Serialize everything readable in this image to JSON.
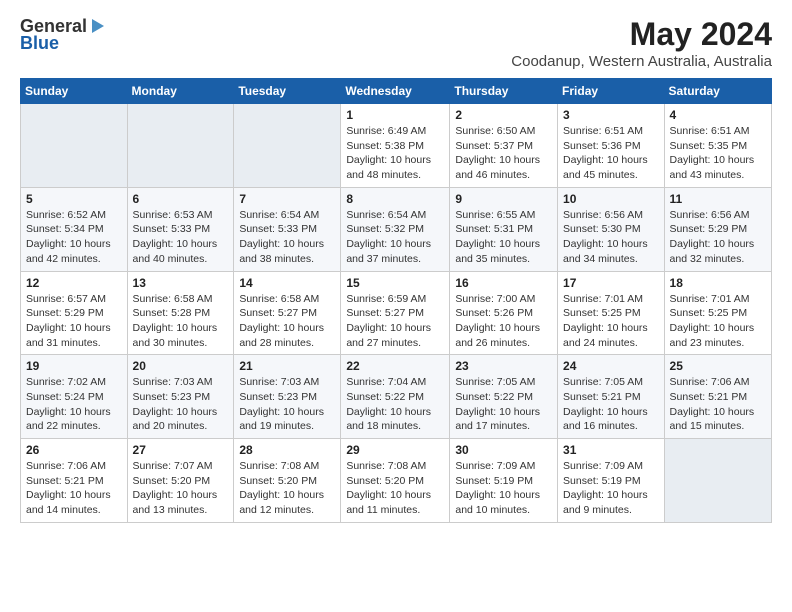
{
  "header": {
    "logo_general": "General",
    "logo_blue": "Blue",
    "title": "May 2024",
    "subtitle": "Coodanup, Western Australia, Australia"
  },
  "weekdays": [
    "Sunday",
    "Monday",
    "Tuesday",
    "Wednesday",
    "Thursday",
    "Friday",
    "Saturday"
  ],
  "weeks": [
    [
      {
        "day": "",
        "info": ""
      },
      {
        "day": "",
        "info": ""
      },
      {
        "day": "",
        "info": ""
      },
      {
        "day": "1",
        "info": "Sunrise: 6:49 AM\nSunset: 5:38 PM\nDaylight: 10 hours\nand 48 minutes."
      },
      {
        "day": "2",
        "info": "Sunrise: 6:50 AM\nSunset: 5:37 PM\nDaylight: 10 hours\nand 46 minutes."
      },
      {
        "day": "3",
        "info": "Sunrise: 6:51 AM\nSunset: 5:36 PM\nDaylight: 10 hours\nand 45 minutes."
      },
      {
        "day": "4",
        "info": "Sunrise: 6:51 AM\nSunset: 5:35 PM\nDaylight: 10 hours\nand 43 minutes."
      }
    ],
    [
      {
        "day": "5",
        "info": "Sunrise: 6:52 AM\nSunset: 5:34 PM\nDaylight: 10 hours\nand 42 minutes."
      },
      {
        "day": "6",
        "info": "Sunrise: 6:53 AM\nSunset: 5:33 PM\nDaylight: 10 hours\nand 40 minutes."
      },
      {
        "day": "7",
        "info": "Sunrise: 6:54 AM\nSunset: 5:33 PM\nDaylight: 10 hours\nand 38 minutes."
      },
      {
        "day": "8",
        "info": "Sunrise: 6:54 AM\nSunset: 5:32 PM\nDaylight: 10 hours\nand 37 minutes."
      },
      {
        "day": "9",
        "info": "Sunrise: 6:55 AM\nSunset: 5:31 PM\nDaylight: 10 hours\nand 35 minutes."
      },
      {
        "day": "10",
        "info": "Sunrise: 6:56 AM\nSunset: 5:30 PM\nDaylight: 10 hours\nand 34 minutes."
      },
      {
        "day": "11",
        "info": "Sunrise: 6:56 AM\nSunset: 5:29 PM\nDaylight: 10 hours\nand 32 minutes."
      }
    ],
    [
      {
        "day": "12",
        "info": "Sunrise: 6:57 AM\nSunset: 5:29 PM\nDaylight: 10 hours\nand 31 minutes."
      },
      {
        "day": "13",
        "info": "Sunrise: 6:58 AM\nSunset: 5:28 PM\nDaylight: 10 hours\nand 30 minutes."
      },
      {
        "day": "14",
        "info": "Sunrise: 6:58 AM\nSunset: 5:27 PM\nDaylight: 10 hours\nand 28 minutes."
      },
      {
        "day": "15",
        "info": "Sunrise: 6:59 AM\nSunset: 5:27 PM\nDaylight: 10 hours\nand 27 minutes."
      },
      {
        "day": "16",
        "info": "Sunrise: 7:00 AM\nSunset: 5:26 PM\nDaylight: 10 hours\nand 26 minutes."
      },
      {
        "day": "17",
        "info": "Sunrise: 7:01 AM\nSunset: 5:25 PM\nDaylight: 10 hours\nand 24 minutes."
      },
      {
        "day": "18",
        "info": "Sunrise: 7:01 AM\nSunset: 5:25 PM\nDaylight: 10 hours\nand 23 minutes."
      }
    ],
    [
      {
        "day": "19",
        "info": "Sunrise: 7:02 AM\nSunset: 5:24 PM\nDaylight: 10 hours\nand 22 minutes."
      },
      {
        "day": "20",
        "info": "Sunrise: 7:03 AM\nSunset: 5:23 PM\nDaylight: 10 hours\nand 20 minutes."
      },
      {
        "day": "21",
        "info": "Sunrise: 7:03 AM\nSunset: 5:23 PM\nDaylight: 10 hours\nand 19 minutes."
      },
      {
        "day": "22",
        "info": "Sunrise: 7:04 AM\nSunset: 5:22 PM\nDaylight: 10 hours\nand 18 minutes."
      },
      {
        "day": "23",
        "info": "Sunrise: 7:05 AM\nSunset: 5:22 PM\nDaylight: 10 hours\nand 17 minutes."
      },
      {
        "day": "24",
        "info": "Sunrise: 7:05 AM\nSunset: 5:21 PM\nDaylight: 10 hours\nand 16 minutes."
      },
      {
        "day": "25",
        "info": "Sunrise: 7:06 AM\nSunset: 5:21 PM\nDaylight: 10 hours\nand 15 minutes."
      }
    ],
    [
      {
        "day": "26",
        "info": "Sunrise: 7:06 AM\nSunset: 5:21 PM\nDaylight: 10 hours\nand 14 minutes."
      },
      {
        "day": "27",
        "info": "Sunrise: 7:07 AM\nSunset: 5:20 PM\nDaylight: 10 hours\nand 13 minutes."
      },
      {
        "day": "28",
        "info": "Sunrise: 7:08 AM\nSunset: 5:20 PM\nDaylight: 10 hours\nand 12 minutes."
      },
      {
        "day": "29",
        "info": "Sunrise: 7:08 AM\nSunset: 5:20 PM\nDaylight: 10 hours\nand 11 minutes."
      },
      {
        "day": "30",
        "info": "Sunrise: 7:09 AM\nSunset: 5:19 PM\nDaylight: 10 hours\nand 10 minutes."
      },
      {
        "day": "31",
        "info": "Sunrise: 7:09 AM\nSunset: 5:19 PM\nDaylight: 10 hours\nand 9 minutes."
      },
      {
        "day": "",
        "info": ""
      }
    ]
  ]
}
